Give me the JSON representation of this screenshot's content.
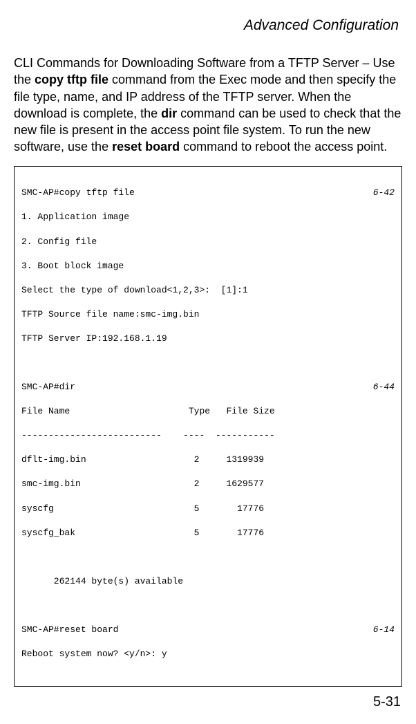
{
  "header": {
    "title": "Advanced Configuration"
  },
  "paragraph": {
    "p1a": "CLI Commands for Downloading Software from a TFTP Server – Use the ",
    "p1b": "copy tftp file",
    "p1c": " command from the Exec mode and then specify the file type, name, and IP address of the TFTP server. When the download is complete, the ",
    "p1d": "dir",
    "p1e": " command can be used to check that the new file is present in the access point file system. To run the new software, use the ",
    "p1f": "reset board",
    "p1g": " command to reboot the access point."
  },
  "cli": {
    "line1_cmd": "SMC-AP#copy tftp file",
    "line1_ref": "6-42",
    "line2": "1. Application image",
    "line3": "2. Config file",
    "line4": "3. Boot block image",
    "line5": "Select the type of download<1,2,3>:  [1]:1",
    "line6": "TFTP Source file name:smc-img.bin",
    "line7": "TFTP Server IP:192.168.1.19",
    "blank1": "",
    "line8_cmd": "SMC-AP#dir",
    "line8_ref": "6-44",
    "line9": "File Name                      Type   File Size",
    "line10": "--------------------------    ----  -----------",
    "line11": "dflt-img.bin                    2     1319939",
    "line12": "smc-img.bin                     2     1629577",
    "line13": "syscfg                          5       17776",
    "line14": "syscfg_bak                      5       17776",
    "blank2": "",
    "line15": "      262144 byte(s) available",
    "blank3": "",
    "line16_cmd": "SMC-AP#reset board",
    "line16_ref": "6-14",
    "line17": "Reboot system now? <y/n>: y"
  },
  "footer": {
    "page": "5-31"
  }
}
